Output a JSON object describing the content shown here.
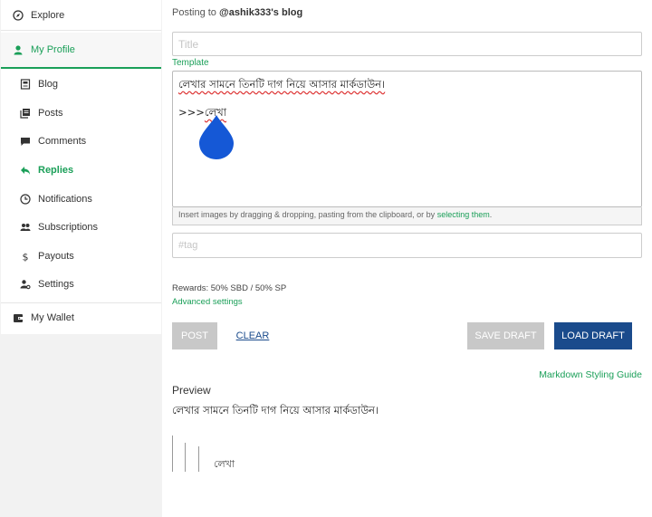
{
  "sidebar": {
    "explore": "Explore",
    "my_profile": "My Profile",
    "items": [
      {
        "label": "Blog",
        "icon": "blog-icon"
      },
      {
        "label": "Posts",
        "icon": "posts-icon"
      },
      {
        "label": "Comments",
        "icon": "comments-icon"
      },
      {
        "label": "Replies",
        "icon": "replies-icon",
        "active": true
      },
      {
        "label": "Notifications",
        "icon": "clock-icon"
      },
      {
        "label": "Subscriptions",
        "icon": "users-icon"
      },
      {
        "label": "Payouts",
        "icon": "dollar-icon"
      },
      {
        "label": "Settings",
        "icon": "user-cog-icon"
      }
    ],
    "wallet": "My Wallet"
  },
  "editor": {
    "posting_prefix": "Posting to",
    "posting_blog": "@ashik333's blog",
    "title_placeholder": "Title",
    "template_label": "Template",
    "body_line1": "লেখার সামনে তিনটি দাগ নিয়ে আসার মার্কডাউন।",
    "body_line2_prefix": ">>>",
    "body_line2_word": "লেখা",
    "drop_hint": "Insert images by dragging & dropping, pasting from the clipboard, or by",
    "drop_hint_link": "selecting them",
    "tag_placeholder": "#tag",
    "rewards": "Rewards: 50% SBD / 50% SP",
    "advanced_settings": "Advanced settings"
  },
  "buttons": {
    "post": "Post",
    "clear": "Clear",
    "save_draft": "Save Draft",
    "load_draft": "Load Draft"
  },
  "preview": {
    "markdown_guide": "Markdown Styling Guide",
    "label": "Preview",
    "text": "লেখার সামনে তিনটি দাগ নিয়ে আসার মার্কডাউন।",
    "quote_text": "লেখা"
  },
  "colors": {
    "accent": "#1a9f58",
    "primary": "#1a4b8c",
    "drop": "#1558d6"
  }
}
